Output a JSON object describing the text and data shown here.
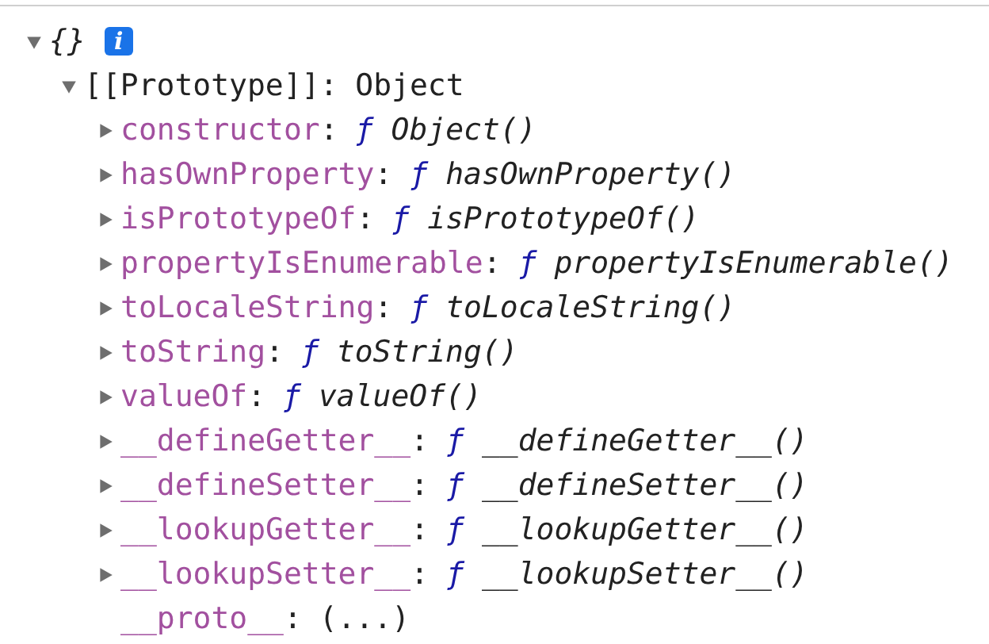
{
  "root": {
    "label": "{}",
    "expanded": true,
    "info": "i",
    "children": [
      {
        "key": "[[Prototype]]",
        "sep": ":",
        "value": "Object",
        "expanded": true,
        "children": [
          {
            "key": "constructor",
            "sep": ":",
            "kind": "function",
            "fn": "ƒ",
            "value": "Object()",
            "expanded": false
          },
          {
            "key": "hasOwnProperty",
            "sep": ":",
            "kind": "function",
            "fn": "ƒ",
            "value": "hasOwnProperty()",
            "expanded": false
          },
          {
            "key": "isPrototypeOf",
            "sep": ":",
            "kind": "function",
            "fn": "ƒ",
            "value": "isPrototypeOf()",
            "expanded": false
          },
          {
            "key": "propertyIsEnumerable",
            "sep": ":",
            "kind": "function",
            "fn": "ƒ",
            "value": "propertyIsEnumerable()",
            "expanded": false
          },
          {
            "key": "toLocaleString",
            "sep": ":",
            "kind": "function",
            "fn": "ƒ",
            "value": "toLocaleString()",
            "expanded": false
          },
          {
            "key": "toString",
            "sep": ":",
            "kind": "function",
            "fn": "ƒ",
            "value": "toString()",
            "expanded": false
          },
          {
            "key": "valueOf",
            "sep": ":",
            "kind": "function",
            "fn": "ƒ",
            "value": "valueOf()",
            "expanded": false
          },
          {
            "key": "__defineGetter__",
            "sep": ":",
            "kind": "function",
            "fn": "ƒ",
            "value": "__defineGetter__()",
            "expanded": false
          },
          {
            "key": "__defineSetter__",
            "sep": ":",
            "kind": "function",
            "fn": "ƒ",
            "value": "__defineSetter__()",
            "expanded": false
          },
          {
            "key": "__lookupGetter__",
            "sep": ":",
            "kind": "function",
            "fn": "ƒ",
            "value": "__lookupGetter__()",
            "expanded": false
          },
          {
            "key": "__lookupSetter__",
            "sep": ":",
            "kind": "function",
            "fn": "ƒ",
            "value": "__lookupSetter__()",
            "expanded": false
          },
          {
            "key": "__proto__",
            "sep": ":",
            "kind": "accessor",
            "value": "(...)"
          }
        ]
      }
    ]
  }
}
